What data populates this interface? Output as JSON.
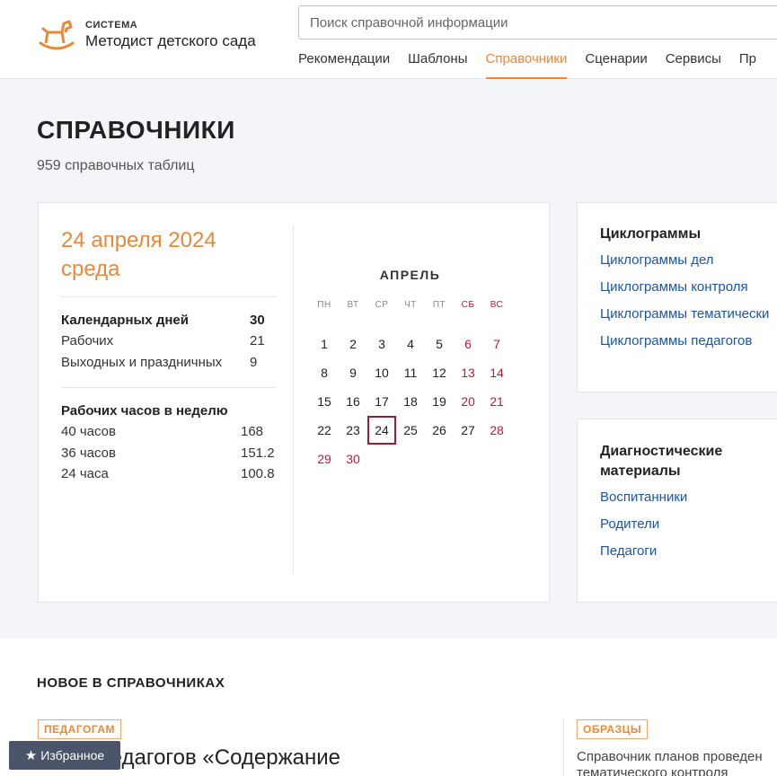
{
  "header": {
    "logo_small": "СИСТЕМА",
    "logo_big": "Методист детского сада",
    "search_placeholder": "Поиск справочной информации",
    "nav": [
      "Рекомендации",
      "Шаблоны",
      "Справочники",
      "Сценарии",
      "Сервисы",
      "Пр"
    ],
    "active_nav": "Справочники",
    "brand_color": "#e8893a"
  },
  "page": {
    "title": "СПРАВОЧНИКИ",
    "subtitle": "959 справочных таблиц"
  },
  "calendar": {
    "date_line1": "24 апреля 2024",
    "date_line2": "среда",
    "days_stats": [
      {
        "label": "Календарных дней",
        "value": "30"
      },
      {
        "label": "Рабочих",
        "value": "21"
      },
      {
        "label": "Выходных и праздничных",
        "value": "9"
      }
    ],
    "hours_title": "Рабочих часов в неделю",
    "hours_stats": [
      {
        "label": "40 часов",
        "value": "168"
      },
      {
        "label": "36 часов",
        "value": "151.2"
      },
      {
        "label": "24 часа",
        "value": "100.8"
      }
    ],
    "month": "АПРЕЛЬ",
    "weekdays": [
      "ПН",
      "ВТ",
      "СР",
      "ЧТ",
      "ПТ",
      "СБ",
      "ВС"
    ],
    "weeks": [
      [
        "1",
        "2",
        "3",
        "4",
        "5",
        "6",
        "7"
      ],
      [
        "8",
        "9",
        "10",
        "11",
        "12",
        "13",
        "14"
      ],
      [
        "15",
        "16",
        "17",
        "18",
        "19",
        "20",
        "21"
      ],
      [
        "22",
        "23",
        "24",
        "25",
        "26",
        "27",
        "28"
      ],
      [
        "29",
        "30",
        "",
        "",
        "",
        "",
        ""
      ]
    ],
    "today": "24",
    "holidays": [
      "6",
      "7",
      "13",
      "14",
      "20",
      "21",
      "28",
      "29",
      "30"
    ],
    "weekend_color": "#c0183a"
  },
  "cyclograms": {
    "title": "Циклограммы",
    "links": [
      "Циклограммы дел",
      "Циклограммы контроля",
      "Циклограммы тематически",
      "Циклограммы педагогов"
    ]
  },
  "diagnostics": {
    "title": "Диагностические материалы",
    "links": [
      "Воспитанники",
      "Родители",
      "Педагоги"
    ]
  },
  "new_section": {
    "title": "НОВОЕ В СПРАВОЧНИКАХ",
    "items": [
      {
        "badge": "ПЕДАГОГАМ",
        "title": "а для педагогов «Содержание"
      },
      {
        "badge": "ОБРАЗЦЫ",
        "title": "Справочник планов проведен тематического контроля"
      }
    ]
  },
  "favorites": {
    "label": "Избранное",
    "icon": "star-icon"
  }
}
